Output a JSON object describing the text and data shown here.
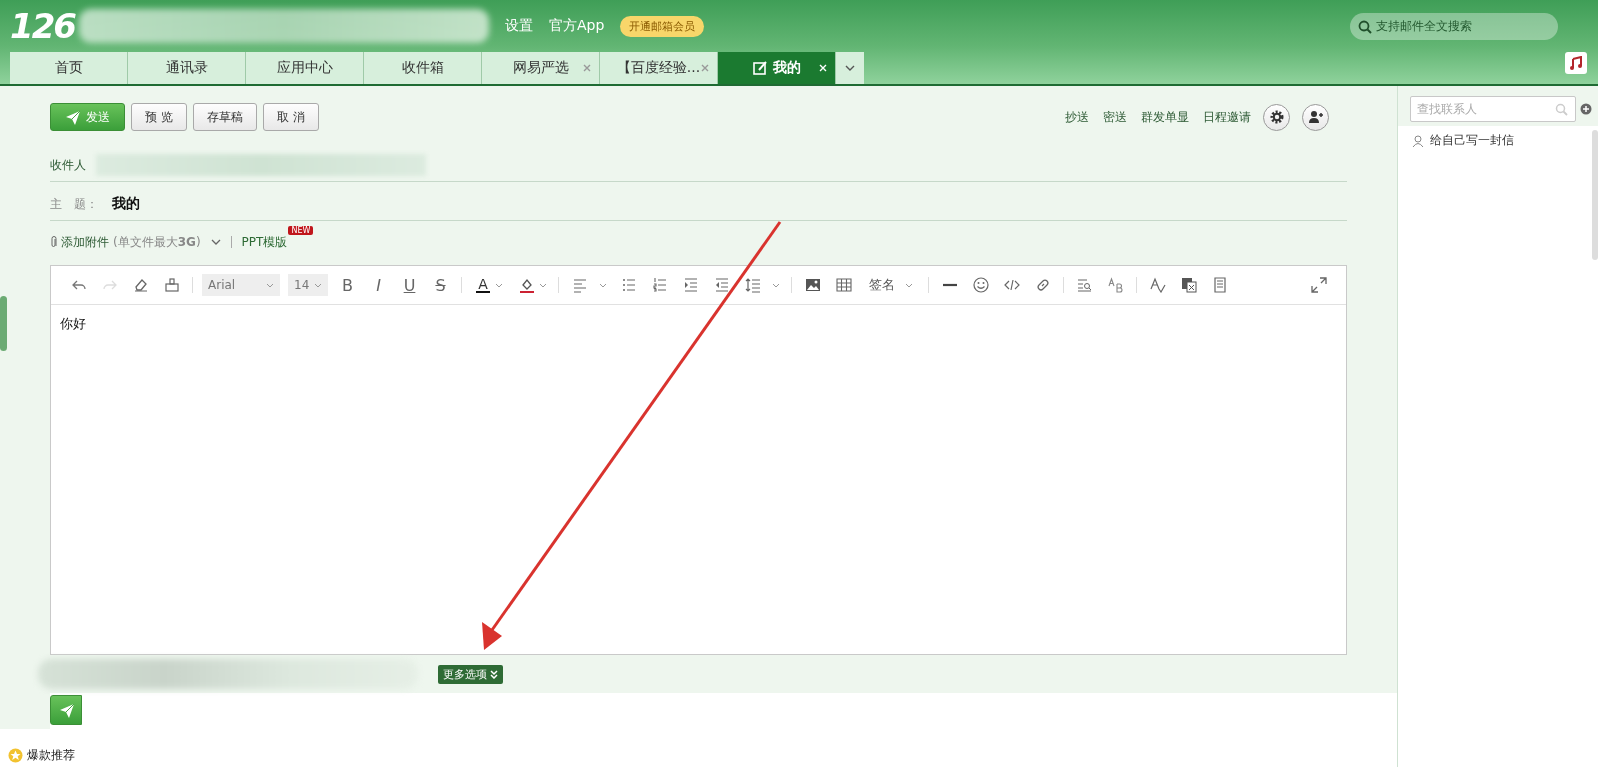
{
  "header": {
    "logo": "126",
    "links": [
      "设置",
      "官方App"
    ],
    "vip_badge": "开通邮箱会员",
    "search": {
      "placeholder": "支持邮件全文搜索"
    }
  },
  "tabs": [
    {
      "label": "首页",
      "selected": false,
      "closable": false
    },
    {
      "label": "通讯录",
      "selected": false,
      "closable": false
    },
    {
      "label": "应用中心",
      "selected": false,
      "closable": false
    },
    {
      "label": "收件箱",
      "selected": false,
      "closable": false
    },
    {
      "label": "网易严选",
      "selected": false,
      "closable": true
    },
    {
      "label": "【百度经验...",
      "selected": false,
      "closable": true
    },
    {
      "label": "我的",
      "selected": true,
      "closable": true,
      "kind": "compose"
    }
  ],
  "compose": {
    "actions": [
      {
        "label": "发送",
        "kind": "primary"
      },
      {
        "label": "预 览",
        "kind": "plain"
      },
      {
        "label": "存草稿",
        "kind": "plain"
      },
      {
        "label": "取 消",
        "kind": "plain"
      }
    ],
    "options": [
      "抄送",
      "密送",
      "群发单显",
      "日程邀请"
    ],
    "recipient_label": "收件人",
    "subject_label": "主　题：",
    "subject": "我的",
    "attach": {
      "label": "添加附件",
      "limit": "(单文件最大**3G**)"
    },
    "ppt": {
      "label": "PPT模版",
      "badge": "NEW"
    },
    "editor": {
      "font": "Arial",
      "size": "14",
      "format_buttons": [
        "B",
        "I",
        "U",
        "S"
      ],
      "font_color": "A",
      "signature": "签名",
      "body": "你好"
    },
    "more_options": "更多选项"
  },
  "contacts": {
    "search": {
      "placeholder": "查找联系人"
    },
    "items": [
      "给自己写一封信"
    ]
  },
  "footer": {
    "promo": "爆款推荐"
  }
}
